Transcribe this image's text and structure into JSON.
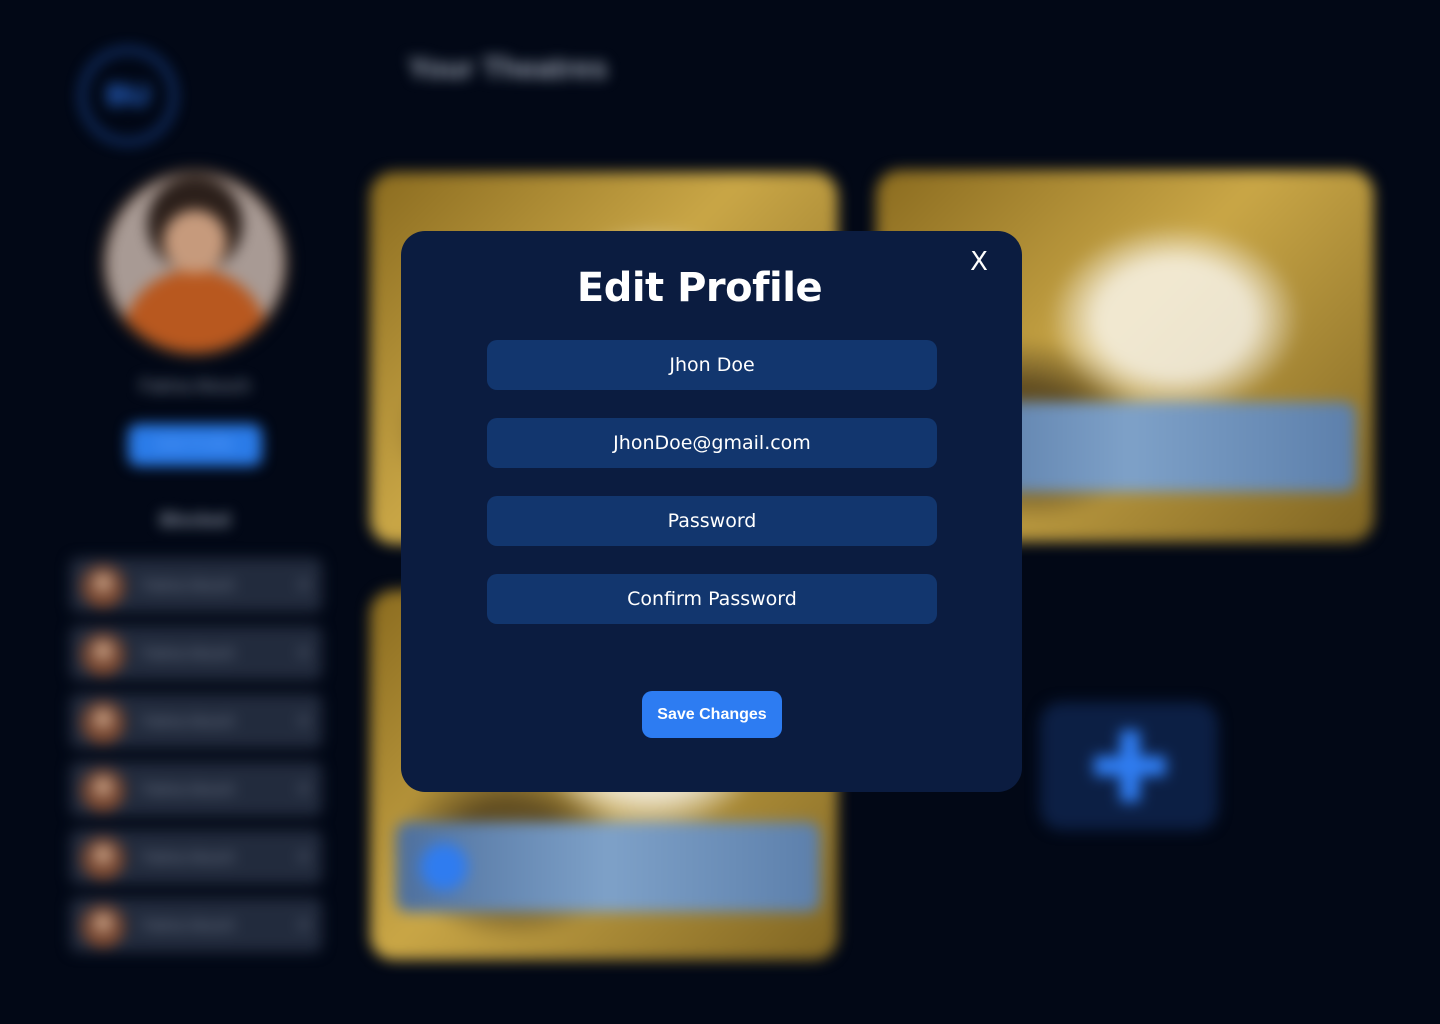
{
  "background": {
    "logo_text": "BU",
    "page_heading": "Your Theatres",
    "profile": {
      "name": "Fatma Atouch",
      "edit_button": "Edit Profile"
    },
    "blocked": {
      "title": "Blocked",
      "items": [
        {
          "name": "Fatma Atouch",
          "remove": "✕"
        },
        {
          "name": "Fatma Atouch",
          "remove": "✕"
        },
        {
          "name": "Fatma Atouch",
          "remove": "✕"
        },
        {
          "name": "Fatma Atouch",
          "remove": "✕"
        },
        {
          "name": "Fatma Atouch",
          "remove": "✕"
        },
        {
          "name": "Fatma Atouch",
          "remove": "✕"
        }
      ]
    }
  },
  "modal": {
    "title": "Edit Profile",
    "close_label": "X",
    "fields": {
      "name": {
        "value": "Jhon Doe",
        "placeholder": ""
      },
      "email": {
        "value": "JhonDoe@gmail.com",
        "placeholder": ""
      },
      "password": {
        "value": "",
        "placeholder": "Password"
      },
      "confirm_password": {
        "value": "",
        "placeholder": "Confirm Password"
      }
    },
    "save_label": "Save Changes"
  },
  "colors": {
    "page_bg": "#020816",
    "modal_bg": "#0b1c40",
    "field_bg": "#12366e",
    "accent": "#2d7cf2"
  }
}
